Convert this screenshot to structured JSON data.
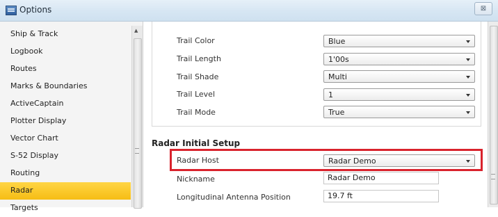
{
  "window": {
    "title": "Options",
    "close_glyph": "⊠",
    "icon": "options-window-icon"
  },
  "sidebar": {
    "items": [
      {
        "label": "Ship & Track"
      },
      {
        "label": "Logbook"
      },
      {
        "label": "Routes"
      },
      {
        "label": "Marks & Boundaries"
      },
      {
        "label": "ActiveCaptain"
      },
      {
        "label": "Plotter Display"
      },
      {
        "label": "Vector Chart"
      },
      {
        "label": "S-52 Display"
      },
      {
        "label": "Routing"
      },
      {
        "label": "Radar",
        "selected": true
      },
      {
        "label": "Targets"
      }
    ],
    "selected_color": "#f6bd14"
  },
  "trail": {
    "rows": [
      {
        "label": "Trail Color",
        "value": "Blue"
      },
      {
        "label": "Trail Length",
        "value": "1'00s"
      },
      {
        "label": "Trail Shade",
        "value": "Multi"
      },
      {
        "label": "Trail Level",
        "value": "1"
      },
      {
        "label": "Trail Mode",
        "value": "True"
      }
    ]
  },
  "radar_setup": {
    "heading": "Radar Initial Setup",
    "host_label": "Radar Host",
    "host_value": "Radar Demo",
    "nickname_label": "Nickname",
    "nickname_value": "Radar Demo",
    "antenna_label": "Longitudinal Antenna Position",
    "antenna_value": "19.7 ft",
    "highlight_color": "#d9232d"
  }
}
